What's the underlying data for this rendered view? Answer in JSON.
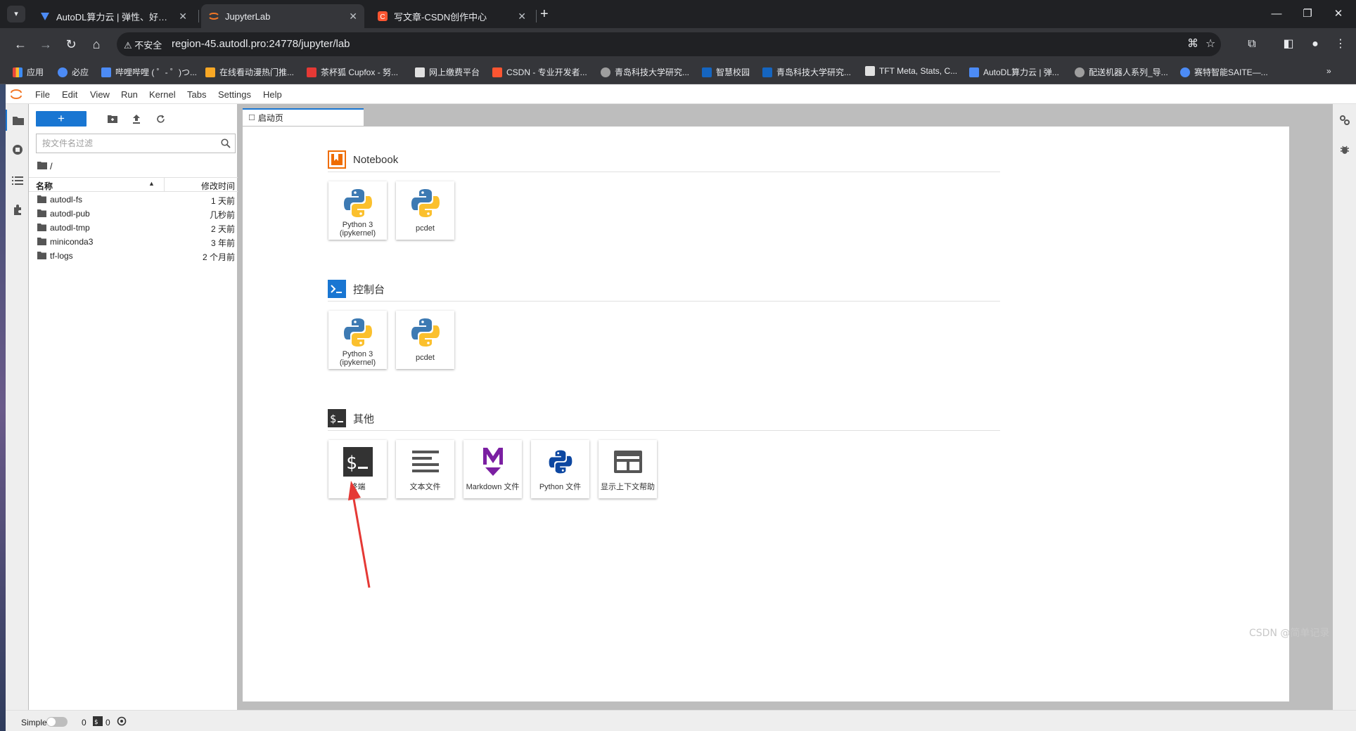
{
  "browser": {
    "tabs": [
      {
        "title": "AutoDL算力云 | 弹性、好用、",
        "icon": "autodl-icon",
        "color": "#4c8bf5"
      },
      {
        "title": "JupyterLab",
        "icon": "jupyter-icon",
        "color": "#f37726",
        "active": true
      },
      {
        "title": "写文章-CSDN创作中心",
        "icon": "csdn-icon",
        "color": "#fc5531"
      }
    ],
    "security_label": "不安全",
    "url": "region-45.autodl.pro:24778/jupyter/lab",
    "bookmarks": [
      {
        "label": "应用",
        "color": "#e8453c"
      },
      {
        "label": "必应",
        "color": "#4c8bf5"
      },
      {
        "label": "哔哩哔哩 ( ゜- ゜)つ...",
        "color": "#4c8bf5"
      },
      {
        "label": "在线看动漫热门推...",
        "color": "#f9a825"
      },
      {
        "label": "茶杯狐 Cupfox - 努...",
        "color": "#e53935"
      },
      {
        "label": "网上缴费平台",
        "color": "#e0e0e0"
      },
      {
        "label": "CSDN - 专业开发者...",
        "color": "#fc5531"
      },
      {
        "label": "青岛科技大学研究...",
        "color": "#9e9e9e"
      },
      {
        "label": "智慧校园",
        "color": "#1565c0"
      },
      {
        "label": "青岛科技大学研究...",
        "color": "#1565c0"
      },
      {
        "label": "TFT Meta, Stats, C...",
        "color": "#e0e0e0"
      },
      {
        "label": "AutoDL算力云 | 弹...",
        "color": "#4c8bf5"
      },
      {
        "label": "配送机器人系列_导...",
        "color": "#9e9e9e"
      },
      {
        "label": "赛特智能SAITE—...",
        "color": "#4c8bf5"
      }
    ]
  },
  "menubar": [
    "File",
    "Edit",
    "View",
    "Run",
    "Kernel",
    "Tabs",
    "Settings",
    "Help"
  ],
  "filebrowser": {
    "new_label": "+",
    "filter_placeholder": "按文件名过滤",
    "breadcrumb": "/",
    "col_name": "名称",
    "col_modified": "修改时间",
    "files": [
      {
        "name": "autodl-fs",
        "modified": "1 天前"
      },
      {
        "name": "autodl-pub",
        "modified": "几秒前"
      },
      {
        "name": "autodl-tmp",
        "modified": "2 天前"
      },
      {
        "name": "miniconda3",
        "modified": "3 年前"
      },
      {
        "name": "tf-logs",
        "modified": "2 个月前"
      }
    ]
  },
  "launcher": {
    "tab_title": "启动页",
    "notebook": {
      "title": "Notebook",
      "cards": [
        {
          "label1": "Python 3",
          "label2": "(ipykernel)"
        },
        {
          "label1": "pcdet",
          "label2": ""
        }
      ]
    },
    "console": {
      "title": "控制台",
      "cards": [
        {
          "label1": "Python 3",
          "label2": "(ipykernel)"
        },
        {
          "label1": "pcdet",
          "label2": ""
        }
      ]
    },
    "other": {
      "title": "其他",
      "cards": [
        {
          "label": "终端"
        },
        {
          "label": "文本文件"
        },
        {
          "label": "Markdown 文件"
        },
        {
          "label": "Python 文件"
        },
        {
          "label": "显示上下文帮助"
        }
      ]
    }
  },
  "statusbar": {
    "mode_label": "Simple",
    "terminals_count": "0",
    "kernels_count": "0"
  },
  "watermark": "CSDN @简单记录"
}
